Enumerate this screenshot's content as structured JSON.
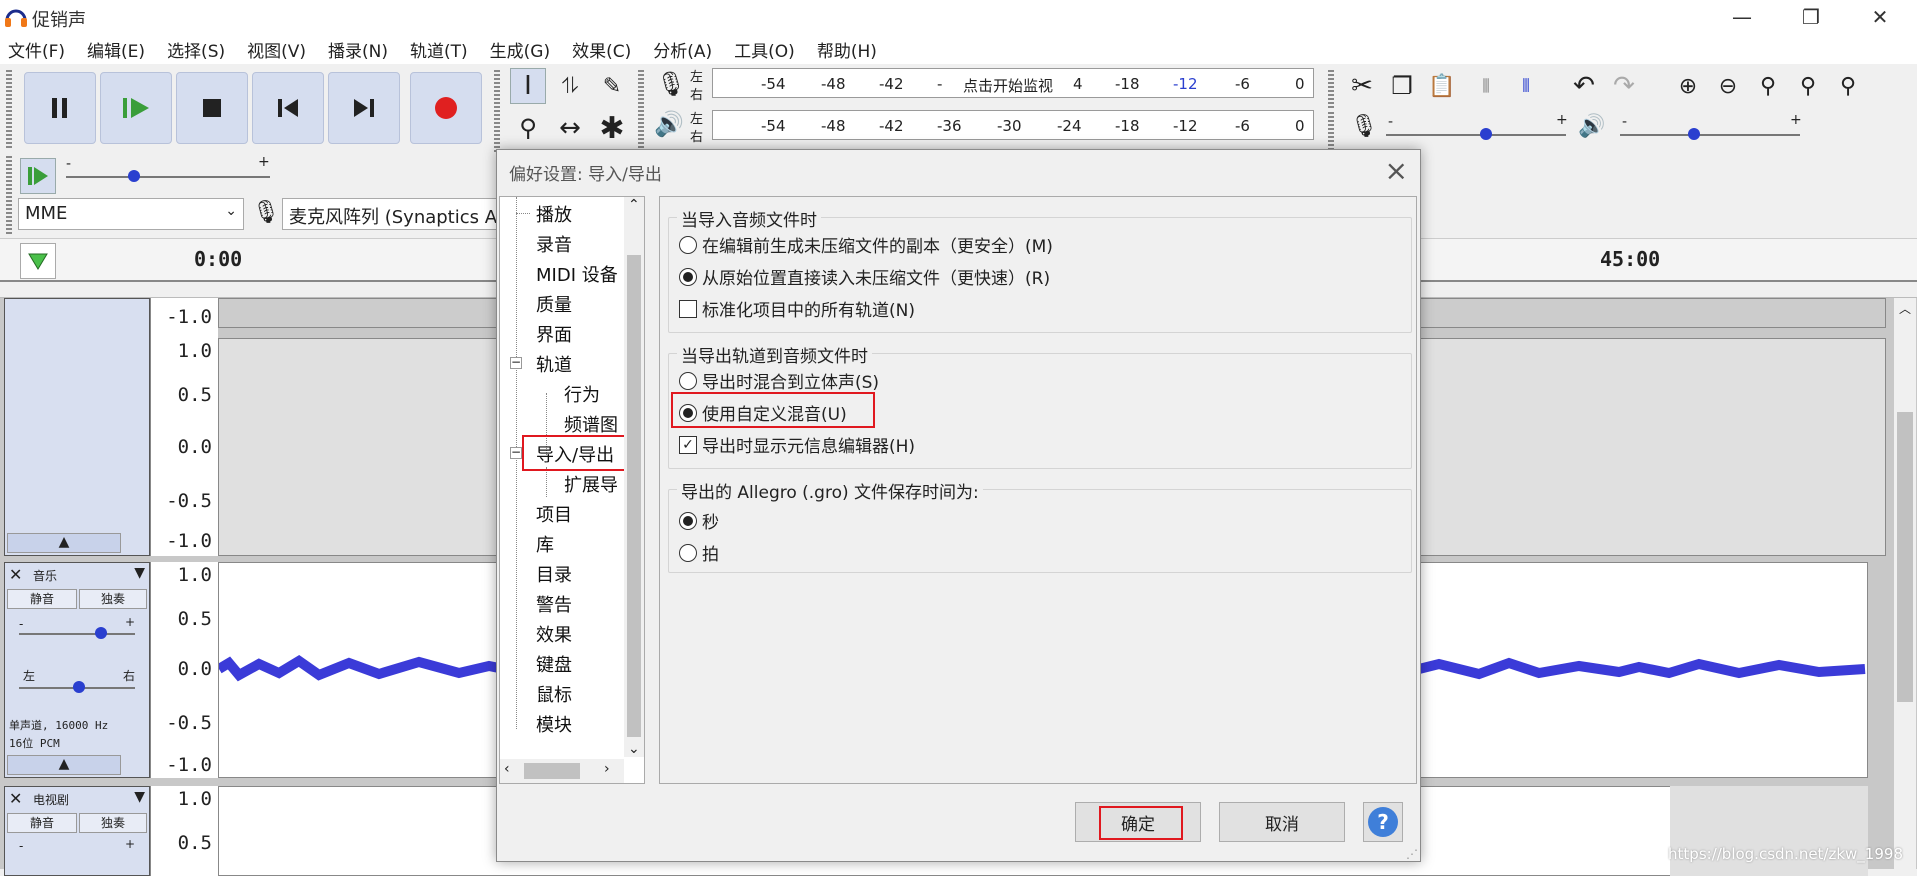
{
  "window": {
    "title": "促销声",
    "minimize": "—",
    "maximize": "❐",
    "close": "✕"
  },
  "menu": [
    "文件(F)",
    "编辑(E)",
    "选择(S)",
    "视图(V)",
    "播录(N)",
    "轨道(T)",
    "生成(G)",
    "效果(C)",
    "分析(A)",
    "工具(O)",
    "帮助(H)"
  ],
  "meters": {
    "record_lr": [
      "左",
      "右"
    ],
    "play_lr": [
      "左",
      "右"
    ],
    "record_ticks": [
      "-54",
      "-48",
      "-42",
      "-",
      "4",
      "-18",
      "-12",
      "-6",
      "0"
    ],
    "record_hint": "点击开始监视",
    "play_ticks": [
      "-54",
      "-48",
      "-42",
      "-36",
      "-30",
      "-24",
      "-18",
      "-12",
      "-6",
      "0"
    ]
  },
  "slider_marks": {
    "minus": "-",
    "plus": "+"
  },
  "device": {
    "host": "MME",
    "input": "麦克风阵列 (Synaptics Au"
  },
  "timeline": {
    "start": "0:00",
    "end": "45:00"
  },
  "tracks": [
    {
      "ruler": [
        "-1.0",
        "1.0",
        "0.5",
        "0.0",
        "-0.5",
        "-1.0"
      ]
    },
    {
      "name": "音乐",
      "mute": "静音",
      "solo": "独奏",
      "left": "左",
      "right": "右",
      "info1": "单声道, 16000 Hz",
      "info2": "16位 PCM",
      "ruler": [
        "1.0",
        "0.5",
        "0.0",
        "-0.5",
        "-1.0"
      ]
    },
    {
      "name": "电视剧",
      "mute": "静音",
      "solo": "独奏",
      "ruler": [
        "1.0",
        "0.5"
      ]
    }
  ],
  "dialog": {
    "title": "偏好设置: 导入/导出",
    "tree": [
      "播放",
      "录音",
      "MIDI 设备",
      "质量",
      "界面",
      "轨道",
      "行为",
      "频谱图",
      "导入/导出",
      "扩展导",
      "项目",
      "库",
      "目录",
      "警告",
      "效果",
      "键盘",
      "鼠标",
      "模块"
    ],
    "import_group": {
      "title": "当导入音频文件时",
      "opt1": "在编辑前生成未压缩文件的副本（更安全）(M)",
      "opt2": "从原始位置直接读入未压缩文件（更快速）(R)",
      "opt3": "标准化项目中的所有轨道(N)"
    },
    "export_group": {
      "title": "当导出轨道到音频文件时",
      "opt1": "导出时混合到立体声(S)",
      "opt2": "使用自定义混音(U)",
      "opt3": "导出时显示元信息编辑器(H)"
    },
    "allegro_group": {
      "title": "导出的 Allegro (.gro) 文件保存时间为:",
      "opt1": "秒",
      "opt2": "拍"
    },
    "ok": "确定",
    "cancel": "取消",
    "help": "?"
  },
  "watermark": "https://blog.csdn.net/zkw_1998",
  "colors": {
    "highlight": "#e0181f",
    "record": "#e02020",
    "wave": "#3b3bd8",
    "help": "#3f7fd9"
  }
}
